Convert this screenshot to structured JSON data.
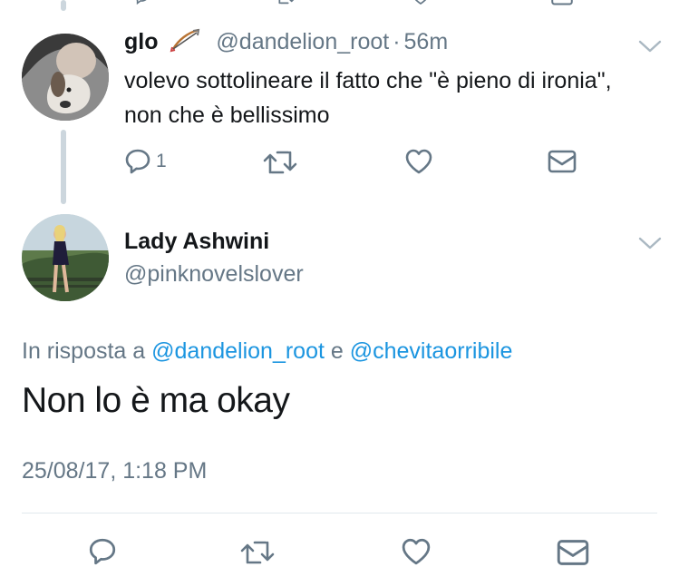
{
  "previous_tweet": {
    "actions": [
      "reply-icon",
      "retweet-icon",
      "like-icon",
      "dm-icon"
    ]
  },
  "reply_tweet": {
    "display_name": "glo",
    "emoji": "bow-and-arrow-icon",
    "handle": "@dandelion_root",
    "separator": "·",
    "time": "56m",
    "text": "volevo sottolineare il fatto che \"è pieno di ironia\", non che è bellissimo",
    "reply_count": "1",
    "actions": [
      "reply-icon",
      "retweet-icon",
      "like-icon",
      "dm-icon"
    ]
  },
  "main_tweet": {
    "display_name": "Lady Ashwini",
    "handle": "@pinknovelslover",
    "in_reply_prefix": "In risposta a",
    "mention_1": "@dandelion_root",
    "conjunction": "e",
    "mention_2": "@chevitaorribile",
    "text": "Non lo è ma okay",
    "timestamp": "25/08/17, 1:18 PM",
    "actions": [
      "reply-icon",
      "retweet-icon",
      "like-icon",
      "dm-icon"
    ]
  },
  "colors": {
    "text": "#14171a",
    "secondary": "#657786",
    "link": "#1b95e0",
    "thread_line": "#ccd6dd",
    "divider": "#e1e8ed"
  }
}
